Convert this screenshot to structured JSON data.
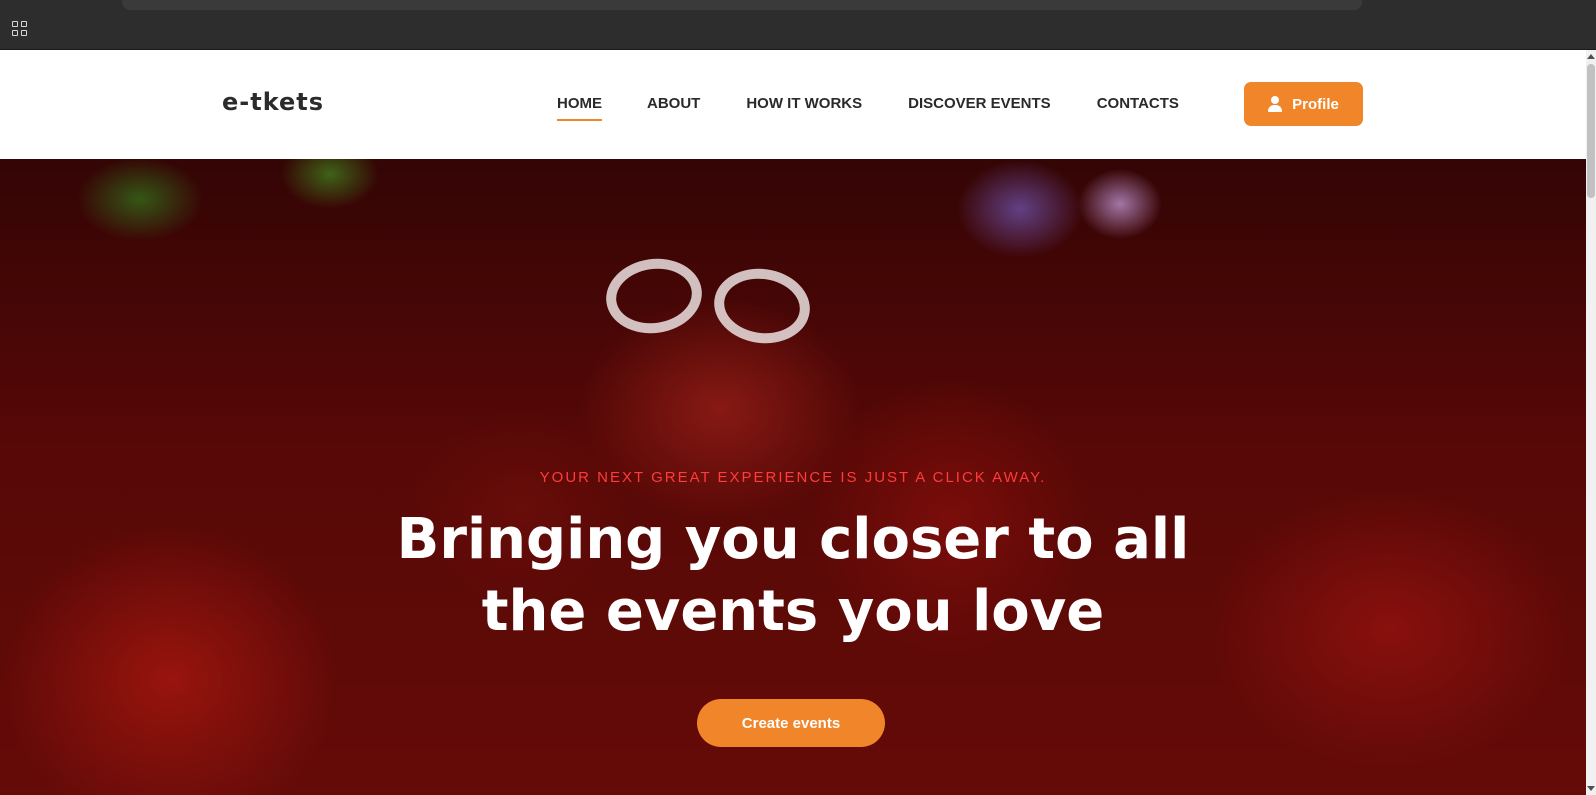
{
  "browser": {
    "apps_icon": "apps-grid-icon"
  },
  "header": {
    "logo": "e-tkets",
    "nav": [
      {
        "label": "HOME",
        "active": true
      },
      {
        "label": "ABOUT",
        "active": false
      },
      {
        "label": "HOW IT WORKS",
        "active": false
      },
      {
        "label": "DISCOVER EVENTS",
        "active": false
      },
      {
        "label": "CONTACTS",
        "active": false
      }
    ],
    "profile_button": {
      "label": "Profile",
      "icon": "user-icon"
    }
  },
  "hero": {
    "tagline": "YOUR NEXT GREAT EXPERIENCE IS JUST A CLICK AWAY.",
    "headline": "Bringing you closer to all the events you love",
    "cta_label": "Create events"
  },
  "colors": {
    "accent": "#f0852a",
    "tagline": "#ff3b3b",
    "text_dark": "#2a2a2a"
  }
}
